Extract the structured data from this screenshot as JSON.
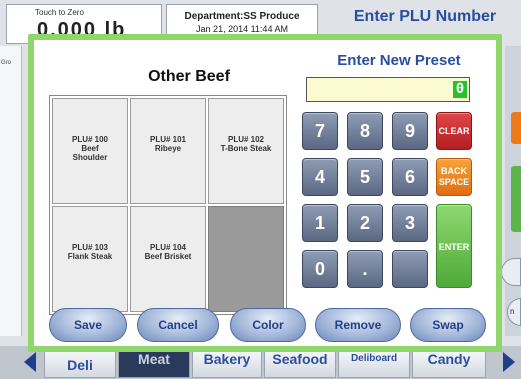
{
  "background": {
    "touch_label": "Touch to Zero",
    "weight_display": "0.000 lb",
    "department": "Department:SS Produce",
    "date_time": "Jan 21, 2014      11:44 AM",
    "plu_title": "Enter PLU Number",
    "left_strip_label": "Gro",
    "right_tab_label": "n"
  },
  "modal": {
    "title": "Other Beef",
    "preset_title": "Enter New Preset",
    "preset_value": "0",
    "cells": [
      {
        "line1": "PLU# 100",
        "line2": "Beef",
        "line3": "Shoulder"
      },
      {
        "line1": "PLU# 101",
        "line2": "Ribeye",
        "line3": ""
      },
      {
        "line1": "PLU# 102",
        "line2": "T-Bone Steak",
        "line3": ""
      },
      {
        "line1": "PLU# 103",
        "line2": "Flank Steak",
        "line3": ""
      },
      {
        "line1": "PLU# 104",
        "line2": "Beef Brisket",
        "line3": ""
      }
    ],
    "keys": {
      "k7": "7",
      "k8": "8",
      "k9": "9",
      "clear": "CLEAR",
      "k4": "4",
      "k5": "5",
      "k6": "6",
      "back1": "BACK",
      "back2": "SPACE",
      "k1": "1",
      "k2": "2",
      "k3": "3",
      "enter": "ENTER",
      "k0": "0",
      "dot": "."
    },
    "buttons": {
      "save": "Save",
      "cancel": "Cancel",
      "color": "Color",
      "remove": "Remove",
      "swap": "Swap"
    }
  },
  "bottom_tabs": [
    "Deli",
    "Meat",
    "Bakery",
    "Seafood",
    "Deliboard",
    "Candy"
  ],
  "colors": {
    "modal_border": "#8fd66b",
    "accent_blue": "#2a4d9e",
    "clear_red": "#c62a2d",
    "back_orange": "#f08a26",
    "enter_green": "#6cc24f"
  }
}
